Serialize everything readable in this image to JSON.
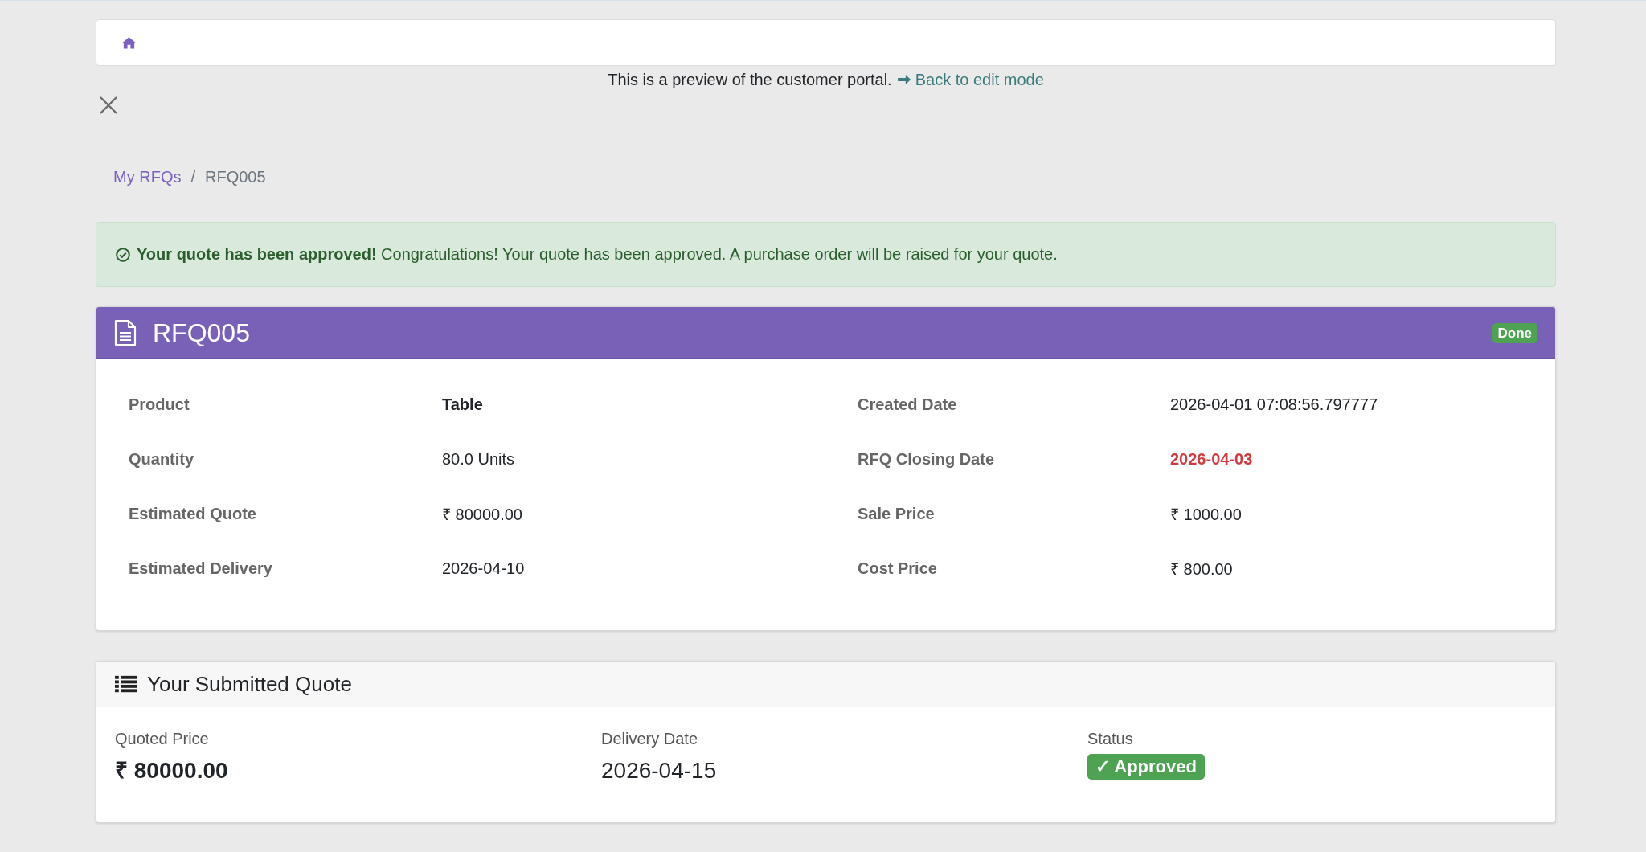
{
  "preview_notice": {
    "text": "This is a preview of the customer portal.",
    "link": "Back to edit mode"
  },
  "breadcrumb": {
    "separator": "/",
    "items": [
      {
        "label": "My RFQs",
        "kind": "link"
      },
      {
        "label": "RFQ005",
        "kind": "current"
      }
    ]
  },
  "alert": {
    "message": "**Your quote has been approved!** Congratulations! Your quote has been approved. A purchase order will be raised for your quote."
  },
  "rfq_card": {
    "title": "RFQ005",
    "status": "Done",
    "fields": [
      {
        "label": "Product",
        "value": "Table",
        "kind": "strong"
      },
      {
        "label": "Created Date",
        "value": "2026-04-01 07:08:56.797777",
        "kind": "plain"
      },
      {
        "label": "Quantity",
        "value": "80.0 Units",
        "kind": "plain"
      },
      {
        "label": "RFQ Closing Date",
        "value": "2026-04-03",
        "kind": "danger"
      },
      {
        "label": "Estimated Quote",
        "value": "₹ 80000.00",
        "kind": "plain"
      },
      {
        "label": "Sale Price",
        "value": "₹ 1000.00",
        "kind": "plain"
      },
      {
        "label": "Estimated Delivery",
        "value": "2026-04-10",
        "kind": "plain"
      },
      {
        "label": "Cost Price",
        "value": "₹ 800.00",
        "kind": "plain"
      }
    ]
  },
  "quote_card": {
    "title": "Your Submitted Quote",
    "fields": [
      {
        "label": "Quoted Price",
        "value": "₹ 80000.00",
        "kind": "amount"
      },
      {
        "label": "Delivery Date",
        "value": "2026-04-15",
        "kind": "date"
      },
      {
        "label": "Status",
        "value": "✓ Approved",
        "kind": "badge"
      }
    ]
  }
}
